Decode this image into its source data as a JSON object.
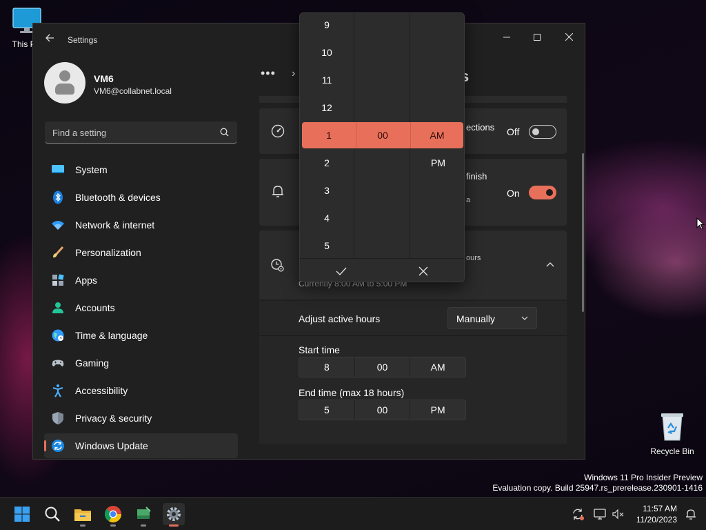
{
  "desktop": {
    "this_pc_label": "This PC",
    "recycle_bin_label": "Recycle Bin",
    "watermark_line1": "Windows 11 Pro Insider Preview",
    "watermark_line2": "Evaluation copy. Build 25947.rs_prerelease.230901-1416"
  },
  "window": {
    "title": "Settings",
    "minimize": "–",
    "maximize": "☐",
    "close": "✕"
  },
  "profile": {
    "name": "VM6",
    "email": "VM6@collabnet.local"
  },
  "search": {
    "placeholder": "Find a setting"
  },
  "nav": {
    "items": [
      {
        "label": "System",
        "icon": "system-icon"
      },
      {
        "label": "Bluetooth & devices",
        "icon": "bluetooth-icon"
      },
      {
        "label": "Network & internet",
        "icon": "wifi-icon"
      },
      {
        "label": "Personalization",
        "icon": "brush-icon"
      },
      {
        "label": "Apps",
        "icon": "apps-icon"
      },
      {
        "label": "Accounts",
        "icon": "accounts-icon"
      },
      {
        "label": "Time & language",
        "icon": "globe-icon"
      },
      {
        "label": "Gaming",
        "icon": "gamepad-icon"
      },
      {
        "label": "Accessibility",
        "icon": "accessibility-icon"
      },
      {
        "label": "Privacy & security",
        "icon": "shield-icon"
      },
      {
        "label": "Windows Update",
        "icon": "update-icon"
      }
    ],
    "active_index": 10
  },
  "content": {
    "breadcrumb_more": "•••",
    "breadcrumb_sep": "›",
    "breadcrumb_tail": "s",
    "metered": {
      "text_fragment": "ections",
      "toggle_label": "Off",
      "toggle_on": false
    },
    "notify": {
      "text_fragment": "finish",
      "sub_fragment": "a",
      "toggle_label": "On",
      "toggle_on": true
    },
    "active_hours": {
      "sub_fragment": "ours",
      "current_fragment": "Currently 8:00 AM to 5:00 PM",
      "adjust_label": "Adjust active hours",
      "adjust_value": "Manually",
      "start_label": "Start time",
      "start": {
        "hour": "8",
        "minute": "00",
        "period": "AM"
      },
      "end_label": "End time (max 18 hours)",
      "end": {
        "hour": "5",
        "minute": "00",
        "period": "PM"
      }
    }
  },
  "flyout": {
    "hours": [
      "9",
      "10",
      "11",
      "12",
      "1",
      "2",
      "3",
      "4",
      "5"
    ],
    "selected_hour": "1",
    "selected_minute": "00",
    "periods": [
      "AM",
      "PM"
    ],
    "selected_period": "AM",
    "accept_icon": "check-icon",
    "dismiss_icon": "x-icon"
  },
  "taskbar": {
    "time": "11:57 AM",
    "date": "11/20/2023"
  },
  "colors": {
    "accent": "#e8705a",
    "window_bg": "#202020",
    "card_bg": "#2b2b2b"
  }
}
